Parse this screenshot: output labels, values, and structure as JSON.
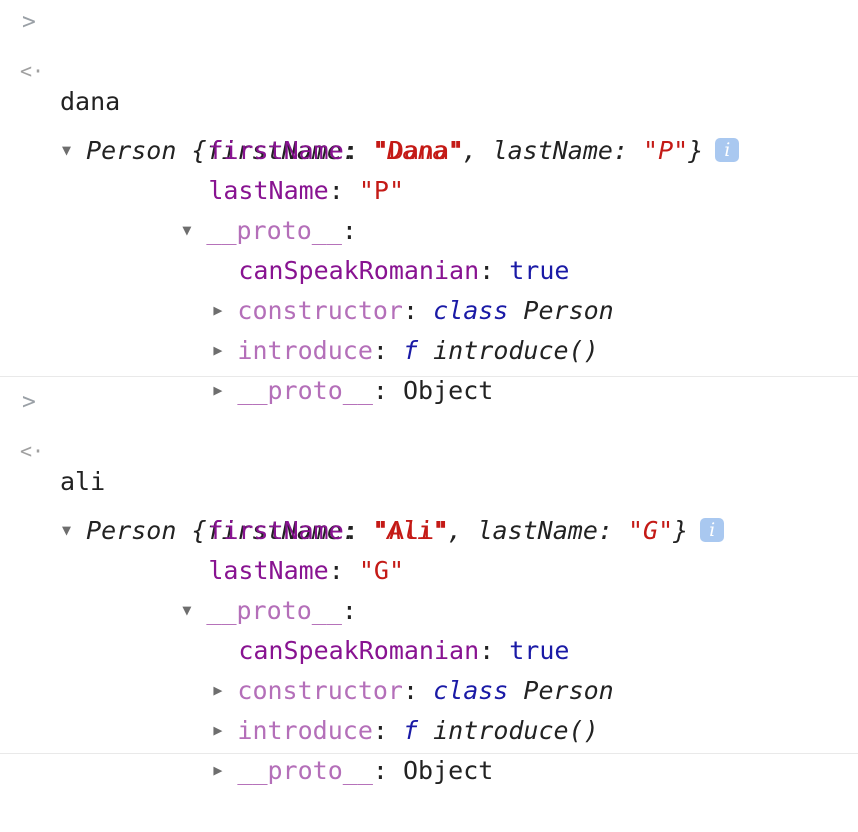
{
  "entries": [
    {
      "input": "dana",
      "summary": {
        "class_name": "Person",
        "k1": "firstName",
        "v1": "\"Dana\"",
        "k2": "lastName",
        "v2": "\"P\""
      },
      "own": [
        {
          "key": "firstName",
          "value": "\"Dana\""
        },
        {
          "key": "lastName",
          "value": "\"P\""
        }
      ],
      "proto_key": "__proto__",
      "proto": {
        "canSpeakRomanian": {
          "key": "canSpeakRomanian",
          "value": "true"
        },
        "constructor": {
          "key": "constructor",
          "keyword": "class",
          "name": "Person"
        },
        "introduce": {
          "key": "introduce",
          "keyword": "f",
          "name": "introduce()"
        },
        "proto": {
          "key": "__proto__",
          "value": "Object"
        }
      }
    },
    {
      "input": "ali",
      "summary": {
        "class_name": "Person",
        "k1": "firstName",
        "v1": "\"Ali\"",
        "k2": "lastName",
        "v2": "\"G\""
      },
      "own": [
        {
          "key": "firstName",
          "value": "\"Ali\""
        },
        {
          "key": "lastName",
          "value": "\"G\""
        }
      ],
      "proto_key": "__proto__",
      "proto": {
        "canSpeakRomanian": {
          "key": "canSpeakRomanian",
          "value": "true"
        },
        "constructor": {
          "key": "constructor",
          "keyword": "class",
          "name": "Person"
        },
        "introduce": {
          "key": "introduce",
          "keyword": "f",
          "name": "introduce()"
        },
        "proto": {
          "key": "__proto__",
          "value": "Object"
        }
      }
    }
  ],
  "glyphs": {
    "prompt": ">",
    "return": "<·",
    "expanded": "▼",
    "collapsed": "▶",
    "info": "i"
  },
  "colors": {
    "key": "#881391",
    "inherited_key": "#b46fb9",
    "string": "#c41a16",
    "keyword": "#1a1aa6",
    "info_badge": "#a9c8f0"
  }
}
